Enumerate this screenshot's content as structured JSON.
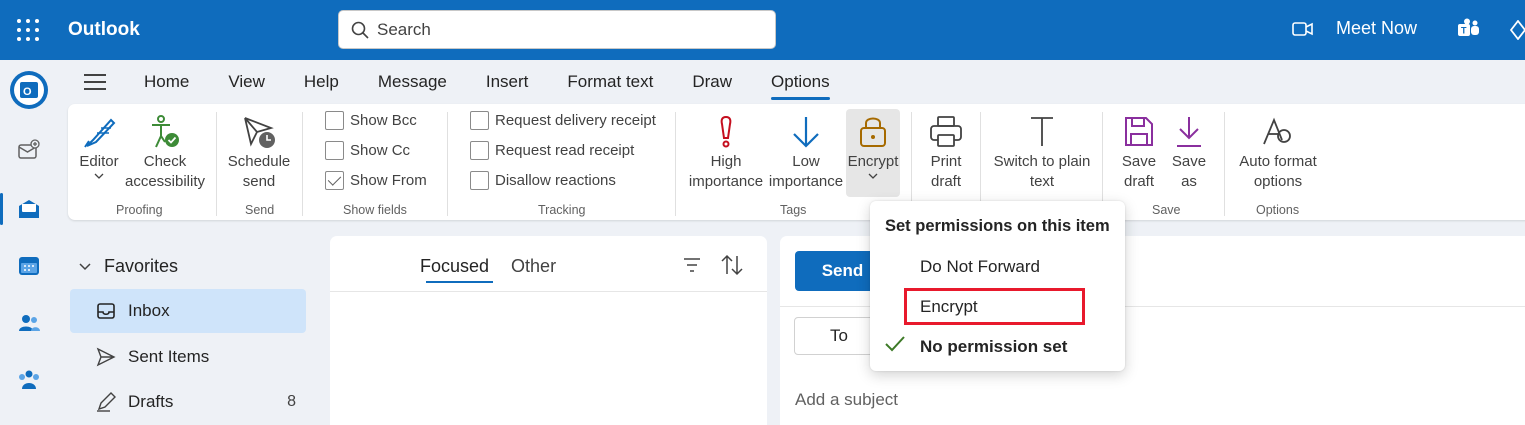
{
  "app": {
    "title": "Outlook"
  },
  "search": {
    "placeholder": "Search"
  },
  "header": {
    "meet_now": "Meet Now"
  },
  "tabs": [
    {
      "label": "Home"
    },
    {
      "label": "View"
    },
    {
      "label": "Help"
    },
    {
      "label": "Message"
    },
    {
      "label": "Insert"
    },
    {
      "label": "Format text"
    },
    {
      "label": "Draw"
    },
    {
      "label": "Options",
      "active": true
    }
  ],
  "ribbon": {
    "proofing": {
      "label": "Proofing",
      "editor": "Editor",
      "check": "Check",
      "accessibility": "accessibility"
    },
    "send": {
      "label": "Send",
      "schedule": "Schedule",
      "send": "send"
    },
    "show_fields": {
      "label": "Show fields",
      "bcc": "Show Bcc",
      "cc": "Show Cc",
      "from": "Show From",
      "from_checked": true
    },
    "tracking": {
      "label": "Tracking",
      "delivery": "Request delivery receipt",
      "read": "Request read receipt",
      "reactions": "Disallow reactions"
    },
    "tags": {
      "label": "Tags",
      "high1": "High",
      "high2": "importance",
      "low1": "Low",
      "low2": "importance",
      "encrypt": "Encrypt"
    },
    "print": {
      "l1": "Print",
      "l2": "draft"
    },
    "plain": {
      "l1": "Switch to plain",
      "l2": "text"
    },
    "save": {
      "label": "Save",
      "save1": "Save",
      "save2": "draft",
      "saveas1": "Save",
      "saveas2": "as"
    },
    "options": {
      "label": "Options",
      "auto1": "Auto format",
      "auto2": "options"
    }
  },
  "folders": {
    "favorites": "Favorites",
    "items": [
      {
        "label": "Inbox",
        "selected": true,
        "count": ""
      },
      {
        "label": "Sent Items",
        "count": ""
      },
      {
        "label": "Drafts",
        "count": "8"
      }
    ]
  },
  "message_list": {
    "focused": "Focused",
    "other": "Other"
  },
  "compose": {
    "send": "Send",
    "to": "To",
    "subject_placeholder": "Add a subject"
  },
  "dropdown": {
    "title": "Set permissions on this item",
    "items": [
      {
        "label": "Do Not Forward"
      },
      {
        "label": "Encrypt",
        "highlighted": true
      },
      {
        "label": "No permission set",
        "checked": true
      }
    ]
  },
  "colors": {
    "brand": "#0f6cbd",
    "highlight": "#e8192c",
    "selected": "#cfe4fa"
  }
}
